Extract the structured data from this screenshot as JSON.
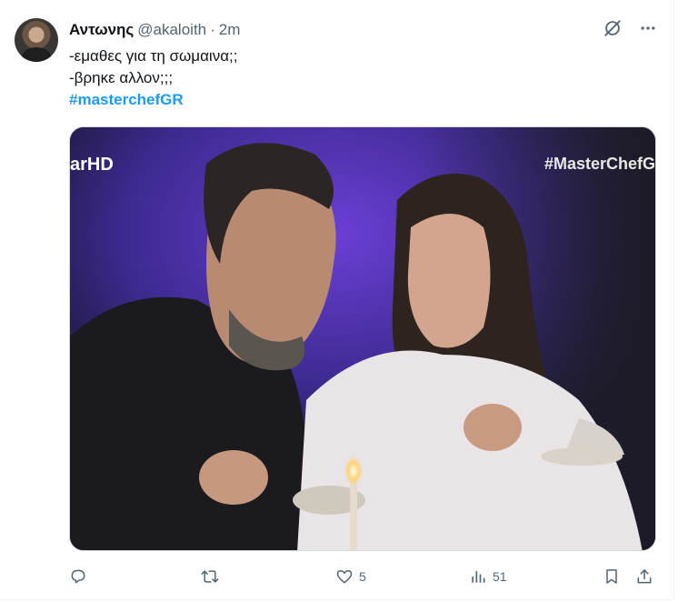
{
  "tweet": {
    "display_name": "Αντωνης",
    "handle": "@akaloith",
    "separator": "·",
    "time": "2m",
    "lines": [
      "-εμαθες για τη σωμαινα;;",
      "-βρηκε αλλον;;;"
    ],
    "hashtag": "#masterchefGR"
  },
  "media": {
    "logo_left": "arHD",
    "logo_right": "#MasterChefG"
  },
  "actions": {
    "reply_count": "",
    "retweet_count": "",
    "like_count": "5",
    "views_count": "51"
  },
  "icons": {
    "header": [
      "grok-icon",
      "more-icon"
    ],
    "actions": [
      "reply-icon",
      "retweet-icon",
      "like-icon",
      "views-icon",
      "bookmark-icon",
      "share-icon"
    ]
  },
  "colors": {
    "hashtag": "#1d9bf0",
    "secondary_text": "#536471",
    "primary_text": "#0f1419"
  }
}
